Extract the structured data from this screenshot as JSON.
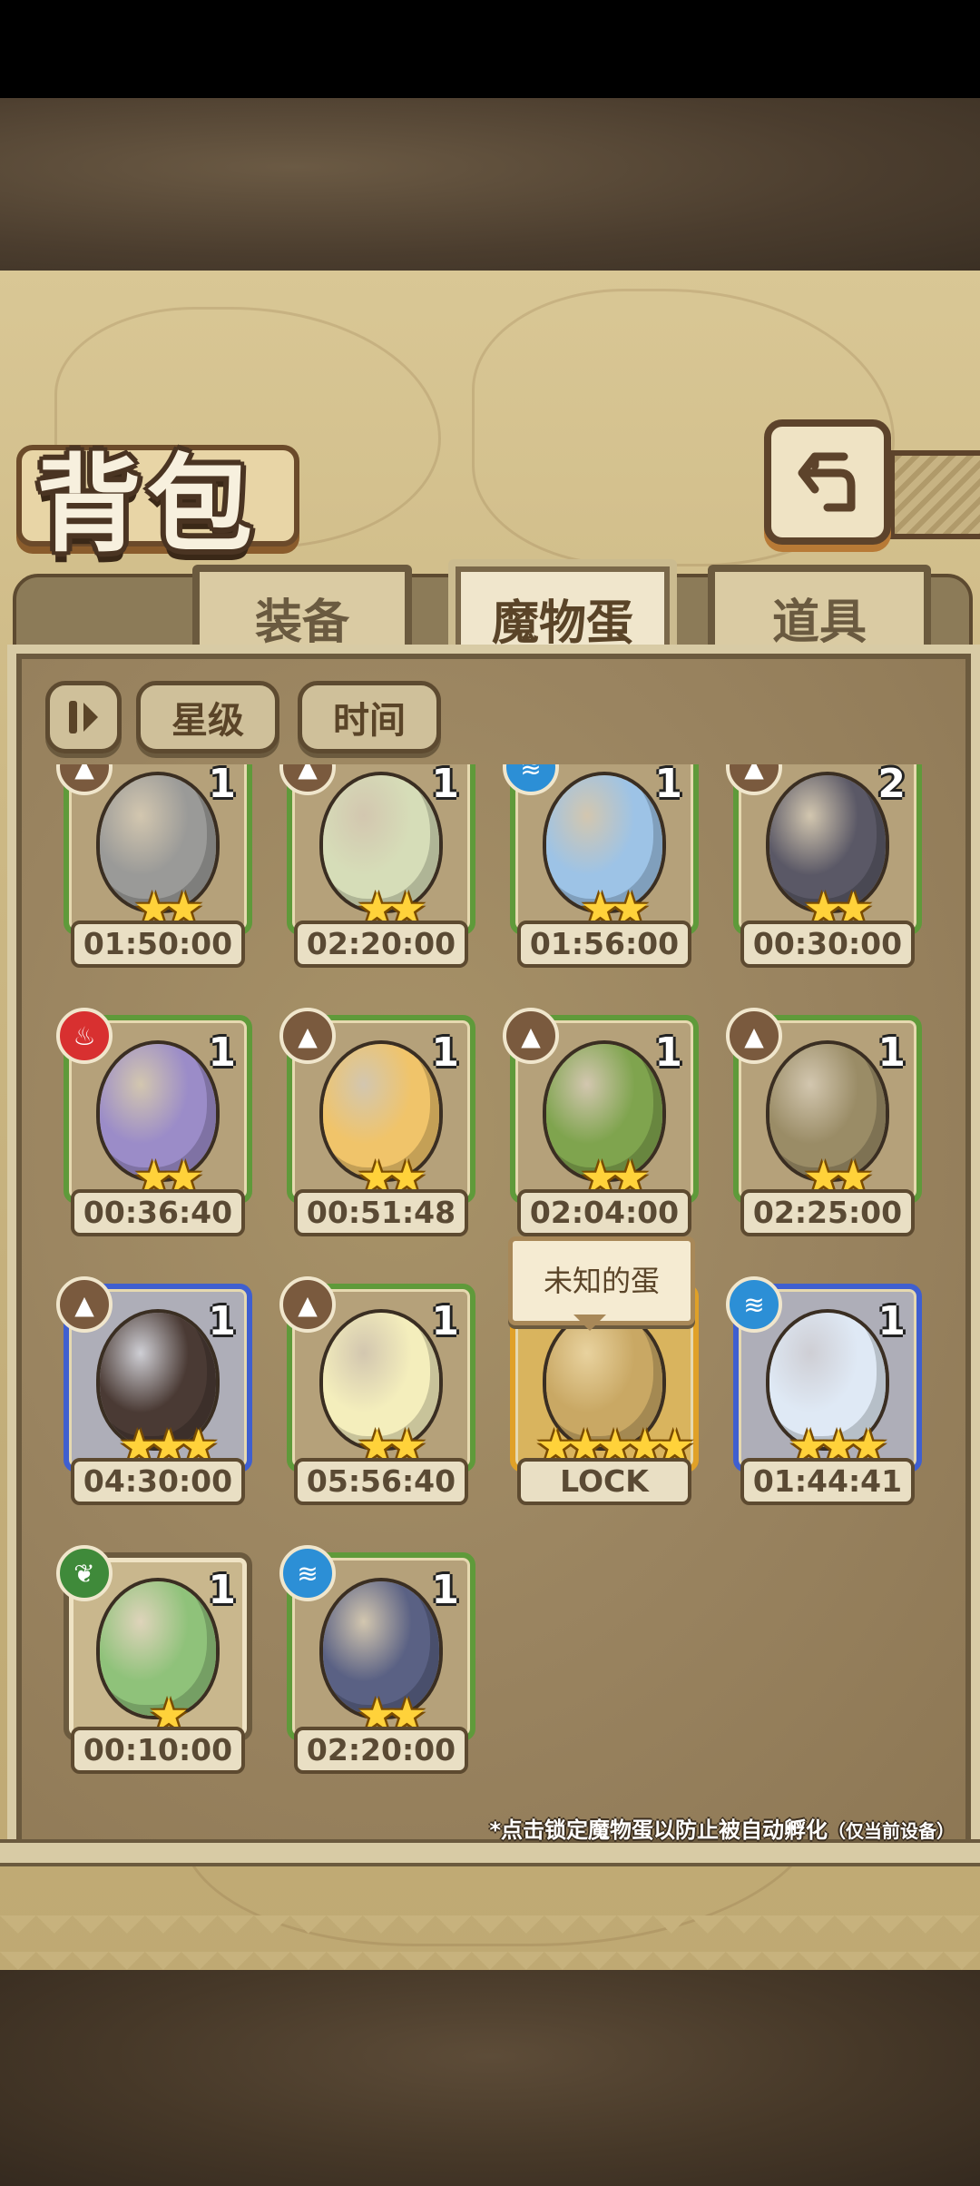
{
  "header": {
    "title": "背包"
  },
  "tabs": [
    {
      "label": "装备",
      "active": false
    },
    {
      "label": "魔物蛋",
      "active": true
    },
    {
      "label": "道具",
      "active": false
    }
  ],
  "filters": {
    "sort_icon": "sort-order-icon",
    "star_label": "星级",
    "time_label": "时间"
  },
  "tooltip": "未知的蛋",
  "footnote": {
    "main": "*点击锁定魔物蛋以防止被自动孵化",
    "device": "（仅当前设备）"
  },
  "eggs": [
    {
      "count": "1",
      "stars": "★★",
      "time": "01:50:00",
      "element": "earth",
      "frame": "green",
      "color": "#9a9a98"
    },
    {
      "count": "1",
      "stars": "★★",
      "time": "02:20:00",
      "element": "earth",
      "frame": "green",
      "color": "#d6ddb8"
    },
    {
      "count": "1",
      "stars": "★★",
      "time": "01:56:00",
      "element": "water",
      "frame": "green",
      "color": "#9dc3e6"
    },
    {
      "count": "2",
      "stars": "★★",
      "time": "00:30:00",
      "element": "earth",
      "frame": "green",
      "color": "#5a5866"
    },
    {
      "count": "1",
      "stars": "★★",
      "time": "00:36:40",
      "element": "fire",
      "frame": "green",
      "color": "#9b8cc8"
    },
    {
      "count": "1",
      "stars": "★★",
      "time": "00:51:48",
      "element": "earth",
      "frame": "green",
      "color": "#f0c46a"
    },
    {
      "count": "1",
      "stars": "★★",
      "time": "02:04:00",
      "element": "earth",
      "frame": "green",
      "color": "#7fa44e"
    },
    {
      "count": "1",
      "stars": "★★",
      "time": "02:25:00",
      "element": "earth",
      "frame": "green",
      "color": "#9a8c66"
    },
    {
      "count": "1",
      "stars": "★★★",
      "time": "04:30:00",
      "element": "earth",
      "frame": "blue",
      "color": "#4a3a34"
    },
    {
      "count": "1",
      "stars": "★★",
      "time": "05:56:40",
      "element": "earth",
      "frame": "green",
      "color": "#f4eebc"
    },
    {
      "count": "",
      "stars": "★★★★★",
      "time": "LOCK",
      "element": "",
      "frame": "gold",
      "color": "#c9a864"
    },
    {
      "count": "1",
      "stars": "★★★",
      "time": "01:44:41",
      "element": "water",
      "frame": "blue",
      "color": "#dfe9f5"
    },
    {
      "count": "1",
      "stars": "★",
      "time": "00:10:00",
      "element": "plant",
      "frame": "plain",
      "color": "#8fc27a"
    },
    {
      "count": "1",
      "stars": "★★",
      "time": "02:20:00",
      "element": "water",
      "frame": "green",
      "color": "#5a6184"
    }
  ]
}
